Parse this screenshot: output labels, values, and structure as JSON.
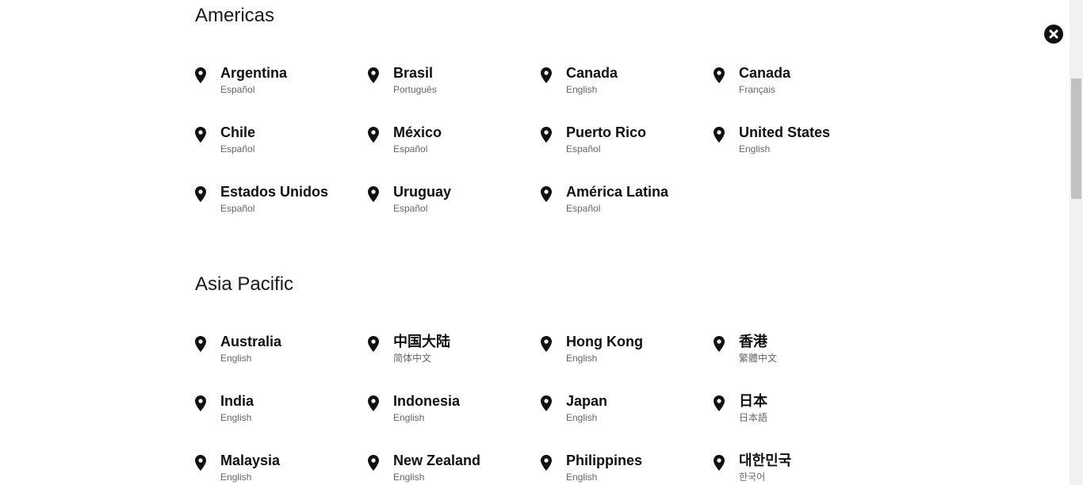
{
  "regions": [
    {
      "title": "Americas",
      "locations": [
        {
          "country": "Argentina",
          "language": "Español"
        },
        {
          "country": "Brasil",
          "language": "Português"
        },
        {
          "country": "Canada",
          "language": "English"
        },
        {
          "country": "Canada",
          "language": "Français"
        },
        {
          "country": "Chile",
          "language": "Español"
        },
        {
          "country": "México",
          "language": "Español"
        },
        {
          "country": "Puerto Rico",
          "language": "Español"
        },
        {
          "country": "United States",
          "language": "English"
        },
        {
          "country": "Estados Unidos",
          "language": "Español"
        },
        {
          "country": "Uruguay",
          "language": "Español"
        },
        {
          "country": "América Latina",
          "language": "Español"
        }
      ]
    },
    {
      "title": "Asia Pacific",
      "locations": [
        {
          "country": "Australia",
          "language": "English"
        },
        {
          "country": "中国大陆",
          "language": "简体中文"
        },
        {
          "country": "Hong Kong",
          "language": "English"
        },
        {
          "country": "香港",
          "language": "繁體中文"
        },
        {
          "country": "India",
          "language": "English"
        },
        {
          "country": "Indonesia",
          "language": "English"
        },
        {
          "country": "Japan",
          "language": "English"
        },
        {
          "country": "日本",
          "language": "日本語"
        },
        {
          "country": "Malaysia",
          "language": "English"
        },
        {
          "country": "New Zealand",
          "language": "English"
        },
        {
          "country": "Philippines",
          "language": "English"
        },
        {
          "country": "대한민국",
          "language": "한국어"
        }
      ]
    }
  ],
  "icons": {
    "location": "map-pin-icon",
    "close": "close-icon"
  },
  "colors": {
    "text": "#111111",
    "subtext": "#666666",
    "close_bg": "#111111"
  }
}
